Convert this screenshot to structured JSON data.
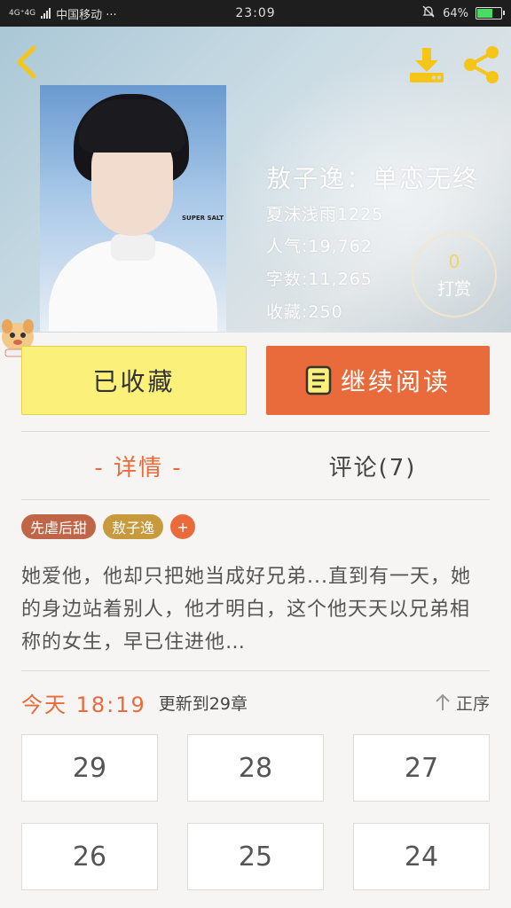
{
  "status_bar": {
    "network": "4G⁺4G",
    "carrier": "中国移动 ···",
    "time": "23:09",
    "battery": "64%",
    "battery_level": 0.64
  },
  "book": {
    "title": "敖子逸：单恋无终",
    "author": "夏沫浅雨1225",
    "popularity": "人气:19,762",
    "word_count": "字数:11,265",
    "favorites": "收藏:250",
    "cover_watermark": "SUPER SALT"
  },
  "tip": {
    "count": "0",
    "label": "打赏"
  },
  "actions": {
    "favorite_label": "已收藏",
    "read_label": "继续阅读"
  },
  "tabs": [
    {
      "label": "- 详情 -"
    },
    {
      "label": "评论(7)"
    }
  ],
  "tags": [
    {
      "label": "先虐后甜"
    },
    {
      "label": "敖子逸"
    }
  ],
  "tag_add": "+",
  "synopsis": "她爱他，他却只把她当成好兄弟...直到有一天，她的身边站着别人，他才明白，这个他天天以兄弟相称的女生，早已住进他…",
  "update": {
    "time": "今天 18:19",
    "text": "更新到29章",
    "sort_label": "正序"
  },
  "chapters": [
    "29",
    "28",
    "27",
    "26",
    "25",
    "24"
  ],
  "colors": {
    "accent": "#e96a3a",
    "favorite_bg": "#fbf07a"
  }
}
